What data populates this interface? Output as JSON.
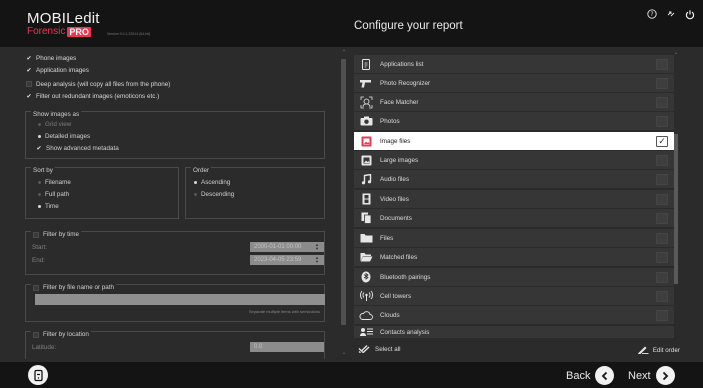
{
  "header": {
    "logo_title": "MOBILedit",
    "logo_sub": "Forensic",
    "logo_pro": "PRO",
    "version": "Version 9.0.1.22914 (64-bit)",
    "title": "Configure your report",
    "icons": [
      "help-icon",
      "fullscreen-icon",
      "power-icon"
    ]
  },
  "left": {
    "phone_images": "Phone images",
    "application_images": "Application images",
    "deep_analysis": "Deep analysis (will copy all files from the phone)",
    "filter_redundant": "Filter out redundant images (emoticons etc.)",
    "show_images_as": {
      "title": "Show images as",
      "grid": "Grid view",
      "detailed": "Detailed images",
      "advanced": "Show advanced metadata"
    },
    "sort_by": {
      "title": "Sort by",
      "filename": "Filename",
      "full_path": "Full path",
      "time": "Time"
    },
    "order": {
      "title": "Order",
      "ascending": "Ascending",
      "descending": "Descending"
    },
    "filter_time": {
      "title": "Filter by time",
      "start_label": "Start:",
      "end_label": "End:",
      "start_value": "2000-01-01 00:00",
      "end_value": "2023-04-05 23:59"
    },
    "filter_name": {
      "title": "Filter by file name or path",
      "value": "",
      "hint": "Separate multiple items with semicolons"
    },
    "filter_location": {
      "title": "Filter by location",
      "latitude_label": "Latitude:",
      "latitude_value": "0.0"
    }
  },
  "list": {
    "items": [
      {
        "label": "Applications list",
        "icon": "document-icon",
        "checked": false
      },
      {
        "label": "Photo Recognizer",
        "icon": "gun-icon",
        "checked": false
      },
      {
        "label": "Face Matcher",
        "icon": "face-icon",
        "checked": false
      },
      {
        "label": "Photos",
        "icon": "camera-icon",
        "checked": false
      },
      {
        "label": "Image files",
        "icon": "image-file-icon",
        "checked": true
      },
      {
        "label": "Large images",
        "icon": "large-image-icon",
        "checked": false
      },
      {
        "label": "Audio files",
        "icon": "music-icon",
        "checked": false
      },
      {
        "label": "Video files",
        "icon": "film-icon",
        "checked": false
      },
      {
        "label": "Documents",
        "icon": "documents-icon",
        "checked": false
      },
      {
        "label": "Files",
        "icon": "folder-icon",
        "checked": false
      },
      {
        "label": "Matched files",
        "icon": "folder-open-icon",
        "checked": false
      },
      {
        "label": "Bluetooth pairings",
        "icon": "bluetooth-icon",
        "checked": false
      },
      {
        "label": "Cell towers",
        "icon": "antenna-icon",
        "checked": false
      },
      {
        "label": "Clouds",
        "icon": "cloud-icon",
        "checked": false
      },
      {
        "label": "Contacts analysis",
        "icon": "contacts-icon",
        "checked": false
      }
    ],
    "select_all": "Select all",
    "edit_order": "Edit order"
  },
  "footer": {
    "back": "Back",
    "next": "Next"
  },
  "colors": {
    "accent": "#e8374f",
    "header_bg": "#141414",
    "panel_bg": "#2b2b2b",
    "row_bg": "#363636",
    "selected_row": "#ffffff"
  }
}
